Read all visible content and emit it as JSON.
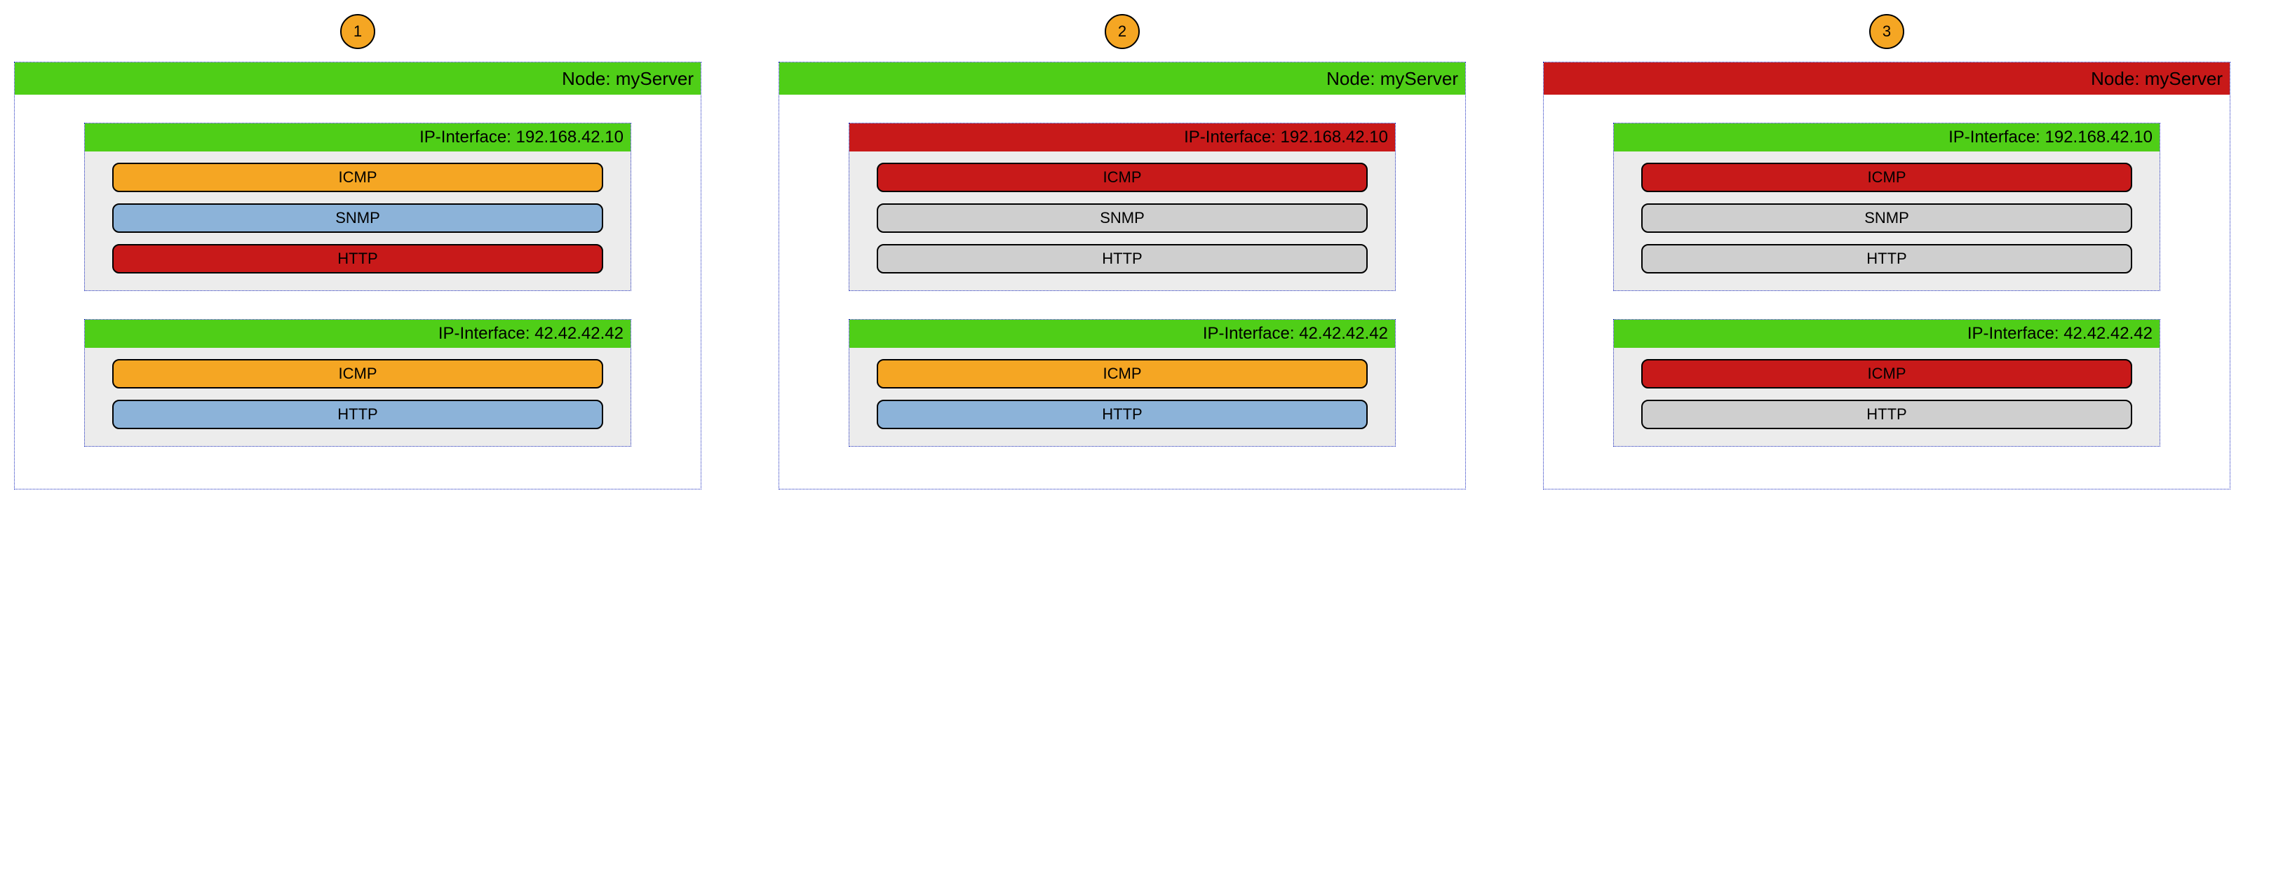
{
  "colors": {
    "green": "#4fce17",
    "red": "#c81919",
    "orange": "#f5a623",
    "blue": "#8cb3d9",
    "grey": "#cfcfcf"
  },
  "columns": [
    {
      "badge": "1",
      "node_label": "Node: myServer",
      "node_color": "green",
      "interfaces": [
        {
          "label": "IP-Interface: 192.168.42.10",
          "header_color": "green",
          "services": [
            {
              "label": "ICMP",
              "color": "orange"
            },
            {
              "label": "SNMP",
              "color": "blue"
            },
            {
              "label": "HTTP",
              "color": "red"
            }
          ]
        },
        {
          "label": "IP-Interface: 42.42.42.42",
          "header_color": "green",
          "services": [
            {
              "label": "ICMP",
              "color": "orange"
            },
            {
              "label": "HTTP",
              "color": "blue"
            }
          ]
        }
      ]
    },
    {
      "badge": "2",
      "node_label": "Node: myServer",
      "node_color": "green",
      "interfaces": [
        {
          "label": "IP-Interface: 192.168.42.10",
          "header_color": "red",
          "services": [
            {
              "label": "ICMP",
              "color": "red"
            },
            {
              "label": "SNMP",
              "color": "grey"
            },
            {
              "label": "HTTP",
              "color": "grey"
            }
          ]
        },
        {
          "label": "IP-Interface: 42.42.42.42",
          "header_color": "green",
          "services": [
            {
              "label": "ICMP",
              "color": "orange"
            },
            {
              "label": "HTTP",
              "color": "blue"
            }
          ]
        }
      ]
    },
    {
      "badge": "3",
      "node_label": "Node: myServer",
      "node_color": "red",
      "interfaces": [
        {
          "label": "IP-Interface: 192.168.42.10",
          "header_color": "green",
          "services": [
            {
              "label": "ICMP",
              "color": "red"
            },
            {
              "label": "SNMP",
              "color": "grey"
            },
            {
              "label": "HTTP",
              "color": "grey"
            }
          ]
        },
        {
          "label": "IP-Interface: 42.42.42.42",
          "header_color": "green",
          "services": [
            {
              "label": "ICMP",
              "color": "red"
            },
            {
              "label": "HTTP",
              "color": "grey"
            }
          ]
        }
      ]
    }
  ]
}
